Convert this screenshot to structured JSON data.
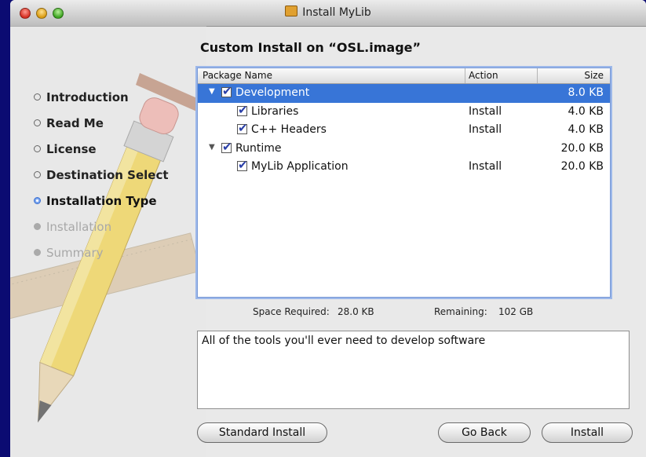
{
  "window": {
    "title": "Install MyLib"
  },
  "heading": "Custom Install on “OSL.image”",
  "steps": [
    {
      "label": "Introduction",
      "state": "done"
    },
    {
      "label": "Read Me",
      "state": "done"
    },
    {
      "label": "License",
      "state": "done"
    },
    {
      "label": "Destination Select",
      "state": "done"
    },
    {
      "label": "Installation Type",
      "state": "current"
    },
    {
      "label": "Installation",
      "state": "future"
    },
    {
      "label": "Summary",
      "state": "future"
    }
  ],
  "table": {
    "headers": {
      "name": "Package Name",
      "action": "Action",
      "size": "Size"
    },
    "rows": [
      {
        "name": "Development",
        "action": "",
        "size": "8.0 KB"
      },
      {
        "name": "Libraries",
        "action": "Install",
        "size": "4.0 KB"
      },
      {
        "name": "C++ Headers",
        "action": "Install",
        "size": "4.0 KB"
      },
      {
        "name": "Runtime",
        "action": "",
        "size": "20.0 KB"
      },
      {
        "name": "MyLib Application",
        "action": "Install",
        "size": "20.0 KB"
      }
    ]
  },
  "space": {
    "required_label": "Space Required:",
    "required_value": "28.0 KB",
    "remaining_label": "Remaining:",
    "remaining_value": "102 GB"
  },
  "description": "All of the tools you'll ever need to develop software",
  "buttons": {
    "standard": "Standard Install",
    "back": "Go Back",
    "install": "Install"
  },
  "colors": {
    "selection": "#3875d7",
    "desktop": "#0b0b72"
  }
}
